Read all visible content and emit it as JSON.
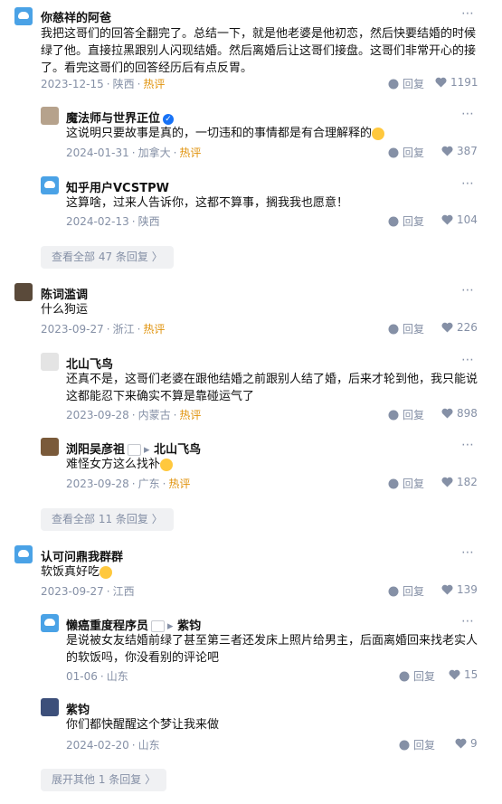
{
  "reply_label": "回复",
  "more_icon": "⋯",
  "hot_label": "热评",
  "threads": [
    {
      "author": "你慈祥的阿爸",
      "text": "我把这哥们的回答全翻完了。总结一下，就是他老婆是他初恋，然后快要结婚的时候绿了他。直接拉黑跟别人闪现结婚。然后离婚后让这哥们接盘。这哥们非常开心的接了。看完这哥们的回答经历后有点反胃。",
      "date": "2023-12-15",
      "location": "陕西",
      "likes": "1191",
      "replies": [
        {
          "author": "魔法师与世界正位",
          "text": "这说明只要故事是真的，一切违和的事情都是有合理解释的",
          "date": "2024-01-31",
          "location": "加拿大",
          "likes": "387"
        },
        {
          "author": "知乎用户VCSTPW",
          "text": "这算啥，过来人告诉你，这都不算事，搁我我也愿意！",
          "date": "2024-02-13",
          "location": "陕西",
          "likes": "104"
        }
      ],
      "view_all": "查看全部 47 条回复"
    },
    {
      "author": "陈词滥调",
      "text": "什么狗运",
      "date": "2023-09-27",
      "location": "浙江",
      "likes": "226",
      "replies": [
        {
          "author": "北山飞鸟",
          "text": "还真不是，这哥们老婆在跟他结婚之前跟别人结了婚，后来才轮到他，我只能说这都能忍下来确实不算是靠碰运气了",
          "date": "2023-09-28",
          "location": "内蒙古",
          "likes": "898"
        },
        {
          "author": "浏阳吴彦祖",
          "reply_to": "北山飞鸟",
          "text": "难怪女方这么找补",
          "date": "2023-09-28",
          "location": "广东",
          "likes": "182"
        }
      ],
      "view_all": "查看全部 11 条回复"
    },
    {
      "author": "认可问鼎我群群",
      "text": "软饭真好吃",
      "date": "2023-09-27",
      "location": "江西",
      "likes": "139",
      "replies": [
        {
          "author": "懒癌重度程序员",
          "reply_to": "紫钧",
          "text": "是说被女友结婚前绿了甚至第三者还发床上照片给男主，后面离婚回来找老实人的软饭吗，你没看别的评论吧",
          "date": "01-06",
          "location": "山东",
          "likes": "15"
        },
        {
          "author": "紫钧",
          "text": "你们都快醒醒这个梦让我来做",
          "date": "2024-02-20",
          "location": "山东",
          "likes": "9"
        }
      ],
      "view_all": "展开其他 1 条回复"
    }
  ]
}
